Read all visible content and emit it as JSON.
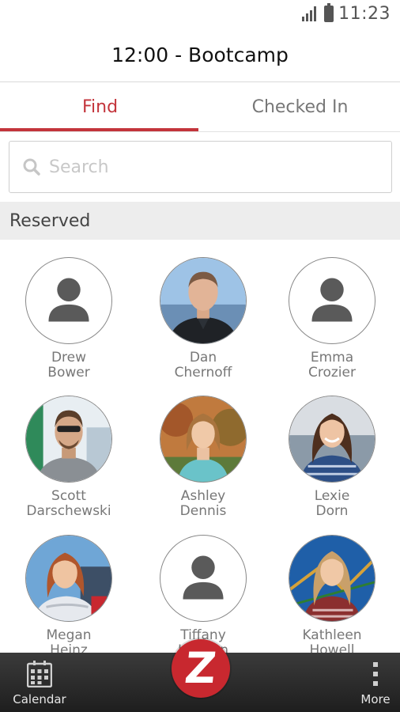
{
  "status_bar": {
    "time": "11:23"
  },
  "header": {
    "title": "12:00 - Bootcamp"
  },
  "tabs": [
    {
      "label": "Find",
      "active": true
    },
    {
      "label": "Checked In",
      "active": false
    }
  ],
  "search": {
    "placeholder": "Search",
    "value": ""
  },
  "section": {
    "title": "Reserved"
  },
  "members": [
    {
      "first": "Drew",
      "last": "Bower",
      "photo": "default"
    },
    {
      "first": "Dan",
      "last": "Chernoff",
      "photo": "man-dark-shirt"
    },
    {
      "first": "Emma",
      "last": "Crozier",
      "photo": "default"
    },
    {
      "first": "Scott",
      "last": "Darschewski",
      "photo": "man-sunglasses"
    },
    {
      "first": "Ashley",
      "last": "Dennis",
      "photo": "woman-autumn"
    },
    {
      "first": "Lexie",
      "last": "Dorn",
      "photo": "woman-plaid"
    },
    {
      "first": "Megan",
      "last": "Heinz",
      "photo": "woman-white-jacket"
    },
    {
      "first": "Tiffany",
      "last": "Hansen",
      "photo": "default"
    },
    {
      "first": "Kathleen",
      "last": "Howell",
      "photo": "woman-playground"
    }
  ],
  "bottom_nav": {
    "calendar_label": "Calendar",
    "more_label": "More",
    "center_letter": "Z"
  },
  "colors": {
    "accent": "#c3343b",
    "brand": "#c8282f",
    "nav_bg": "#2b2b2b"
  }
}
